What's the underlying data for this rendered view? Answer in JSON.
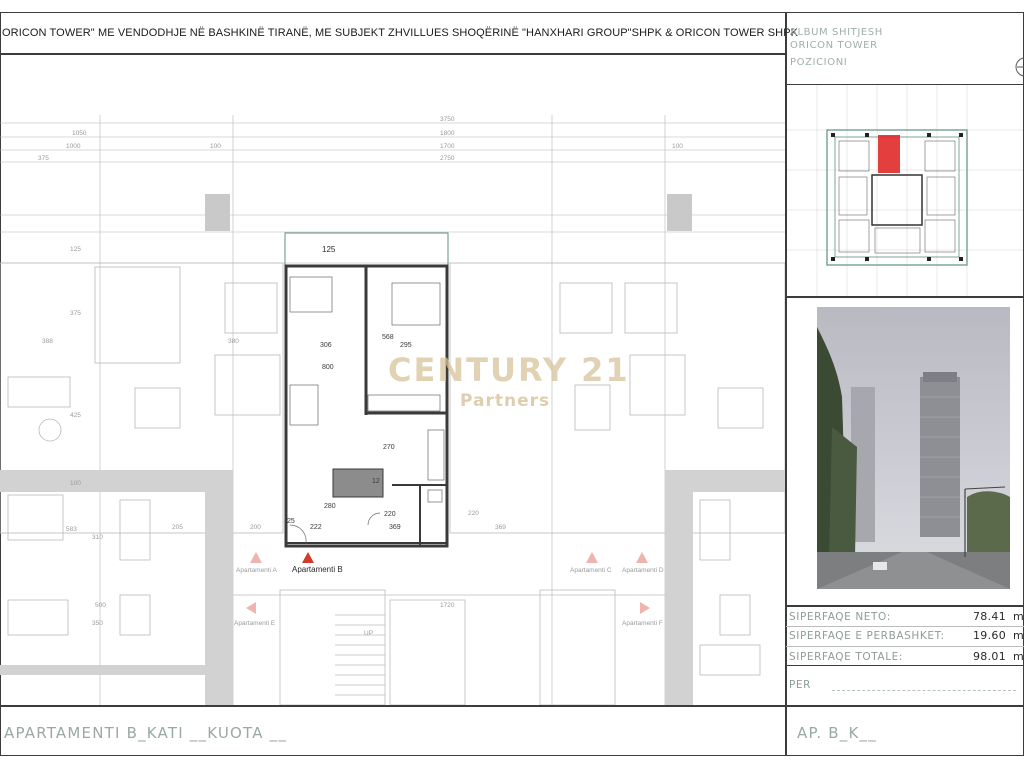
{
  "header": {
    "title": "ORICON TOWER\" ME VENDODHJE NË BASHKINË TIRANË, ME SUBJEKT ZHVILLUES SHOQËRINË \"HANXHARI GROUP\"SHPK & ORICON TOWER SHPK"
  },
  "album": {
    "line1": "ALBUM SHITJESH",
    "line2": "ORICON TOWER"
  },
  "position": {
    "label": "POZICIONI"
  },
  "plan": {
    "overall_dims": [
      "3750",
      "1800",
      "1700",
      "2750",
      "1050",
      "1000",
      "375",
      "100",
      "100"
    ],
    "room_dims": [
      "125",
      "306",
      "800",
      "568",
      "295",
      "270",
      "12",
      "280",
      "220",
      "222",
      "369",
      "25",
      "200",
      "205",
      "220",
      "369",
      "125",
      "375",
      "388",
      "380",
      "425",
      "100",
      "583",
      "310",
      "500",
      "350",
      "1720"
    ],
    "apartment_labels": [
      "Apartamenti B",
      "Apartamenti A",
      "Apartamenti C",
      "Apartamenti D",
      "Apartamenti E",
      "Apartamenti F"
    ],
    "stair_label": "UP"
  },
  "watermark": {
    "brand": "CENTURY 21",
    "sub": "Partners"
  },
  "areas": [
    {
      "label": "SIPERFAQE NETO:",
      "value": "78.41",
      "unit": "m"
    },
    {
      "label": "SIPERFAQE E PERBASHKET:",
      "value": "19.60",
      "unit": "m"
    },
    {
      "label": "SIPERFAQE TOTALE:",
      "value": "98.01",
      "unit": "m"
    }
  ],
  "per": {
    "label": "PER"
  },
  "footer": {
    "left": "APARTAMENTI B_KATI __KUOTA __",
    "right": "AP. B_K__"
  },
  "colors": {
    "highlight": "#e02a2a",
    "wall": "#3a3a3a",
    "frame_green": "#5f8f82"
  }
}
